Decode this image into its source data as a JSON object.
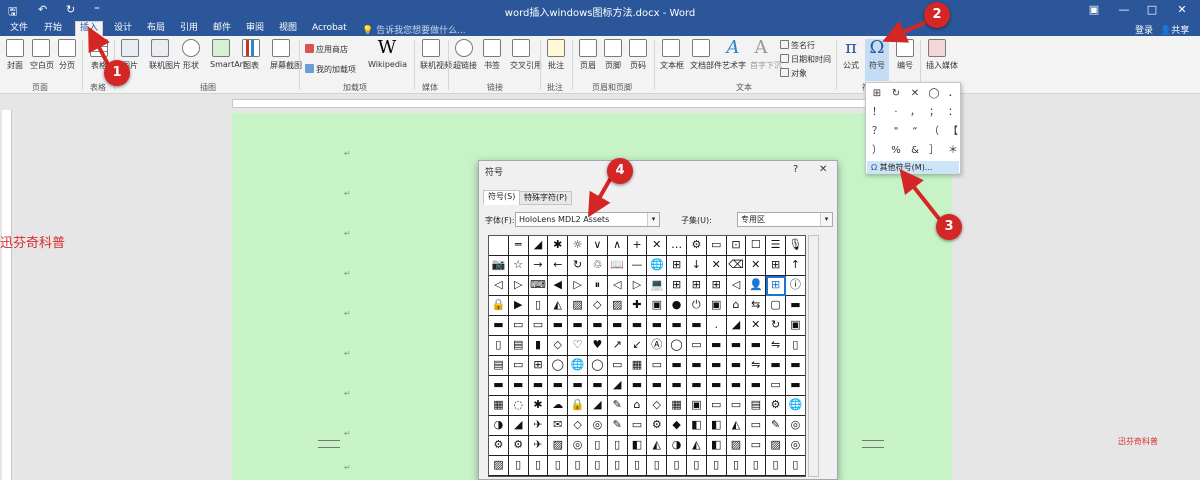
{
  "titlebar": {
    "title": "word插入windows图标方法.docx - Word",
    "qa_save": "🖫",
    "qa_undo": "↶",
    "qa_redo": "↻",
    "qa_custom": "⁼",
    "ribbon_opt": "▣",
    "minimize": "—",
    "maximize": "□",
    "close": "✕"
  },
  "tabs": [
    {
      "label": "文件"
    },
    {
      "label": "开始"
    },
    {
      "label": "插入"
    },
    {
      "label": "设计"
    },
    {
      "label": "布局"
    },
    {
      "label": "引用"
    },
    {
      "label": "邮件"
    },
    {
      "label": "审阅"
    },
    {
      "label": "视图"
    },
    {
      "label": "Acrobat"
    }
  ],
  "tell_me": "告诉我您想要做什么...",
  "signin": "登录",
  "share": "共享",
  "ribbon": {
    "buttons": [
      {
        "label": "封面"
      },
      {
        "label": "空白页"
      },
      {
        "label": "分页"
      },
      {
        "label": "表格"
      },
      {
        "label": "图片"
      },
      {
        "label": "联机图片"
      },
      {
        "label": "形状"
      },
      {
        "label": "SmartArt"
      },
      {
        "label": "图表"
      },
      {
        "label": "屏幕截图"
      },
      {
        "label": "Wikipedia"
      },
      {
        "label": "联机视频"
      },
      {
        "label": "超链接"
      },
      {
        "label": "书签"
      },
      {
        "label": "交叉引用"
      },
      {
        "label": "批注"
      },
      {
        "label": "页眉"
      },
      {
        "label": "页脚"
      },
      {
        "label": "页码"
      },
      {
        "label": "文本框"
      },
      {
        "label": "文档部件"
      },
      {
        "label": "艺术字"
      },
      {
        "label": "首字下沉"
      },
      {
        "label": "公式"
      },
      {
        "label": "符号"
      },
      {
        "label": "编号"
      },
      {
        "label": "插入媒体"
      }
    ],
    "small": {
      "store": "应用商店",
      "myaddins": "我的加载项",
      "signature": "签名行",
      "datetime": "日期和时间",
      "object": "对象"
    },
    "groups": {
      "pages": "页面",
      "tables": "表格",
      "illustrations": "插图",
      "addins": "加载项",
      "media": "媒体",
      "links": "链接",
      "comments": "批注",
      "header_footer": "页眉和页脚",
      "text": "文本",
      "symbols": "符号"
    }
  },
  "symbol_dropdown": {
    "symbols": [
      "⊞",
      "↻",
      "✕",
      "◯",
      "．",
      "！",
      "·",
      "，",
      "；",
      "：",
      "？",
      "\"",
      "“",
      "（",
      "【",
      "）",
      "%",
      "&",
      "］",
      "＊"
    ],
    "more_label": "其他符号(M)..."
  },
  "dialog": {
    "title": "符号",
    "help": "?",
    "close": "✕",
    "tab_symbols": "符号(S)",
    "tab_special": "特殊字符(P)",
    "font_label": "字体(F):",
    "font_value": "HoloLens MDL2 Assets",
    "subset_label": "子集(U):",
    "subset_value": "专用区",
    "arrow": "▾",
    "symbols": [
      "",
      "═",
      "◢",
      "✱",
      "☼",
      "∨",
      "∧",
      "+",
      "✕",
      "…",
      "⚙",
      "▭",
      "⊡",
      "☐",
      "☰",
      "🎙",
      "📷",
      "☆",
      "→",
      "←",
      "↻",
      "♲",
      "📖",
      "—",
      "🌐",
      "⊞",
      "↓",
      "✕",
      "⌫",
      "✕",
      "⊞",
      "↑",
      "◁",
      "▷",
      "⌨",
      "◀",
      "▷",
      "⏸",
      "◁",
      "▷",
      "💻",
      "⊞",
      "⊞",
      "⊞",
      "◁",
      "👤",
      "⊞",
      "ⓘ",
      "🔒",
      "▶",
      "▯",
      "◭",
      "▨",
      "◇",
      "▨",
      "✚",
      "▣",
      "●",
      "⏻",
      "▣",
      "⌂",
      "⇆",
      "▢",
      "▬",
      "▬",
      "▭",
      "▭",
      "▬",
      "▬",
      "▬",
      "▬",
      "▬",
      "▬",
      "▬",
      "▬",
      ".",
      "◢",
      "✕",
      "↻",
      "▣",
      "▯",
      "▤",
      "▮",
      "◇",
      "♡",
      "♥",
      "↗",
      "↙",
      "Ⓐ",
      "◯",
      "▭",
      "▬",
      "▬",
      "▬",
      "⇋",
      "▯",
      "▤",
      "▭",
      "⊞",
      "◯",
      "🌐",
      "◯",
      "▭",
      "▦",
      "▭",
      "▬",
      "▬",
      "▬",
      "▬",
      "⇋",
      "▬",
      "▬",
      "▬",
      "▬",
      "▬",
      "▬",
      "▬",
      "▬",
      "◢",
      "▬",
      "▬",
      "▬",
      "▬",
      "▬",
      "▬",
      "▬",
      "▭",
      "▬",
      "▦",
      "◌",
      "✱",
      "☁",
      "🔒",
      "◢",
      "✎",
      "⌂",
      "◇",
      "▦",
      "▣",
      "▭",
      "▭",
      "▤",
      "⚙",
      "🌐",
      "◑",
      "◢",
      "✈",
      "✉",
      "◇",
      "◎",
      "✎",
      "▭",
      "⚙",
      "◆",
      "◧",
      "◧",
      "◭",
      "▭",
      "✎",
      "◎",
      "⚙",
      "⚙",
      "✈",
      "▨",
      "◎",
      "▯",
      "▯",
      "◧",
      "◭",
      "◑",
      "◭",
      "◧",
      "▨",
      "▭",
      "▨",
      "◎",
      "▨",
      "▯",
      "▯",
      "▯",
      "▯",
      "▯",
      "▯",
      "▯",
      "▯",
      "▯",
      "▯",
      "▯",
      "▯",
      "▯",
      "▯",
      "▯"
    ]
  },
  "callouts": [
    "1",
    "2",
    "3",
    "4"
  ],
  "watermark": "迅芬奇科普",
  "watermark_small": "迅芬奇科普",
  "paragraph_mark": "↵"
}
